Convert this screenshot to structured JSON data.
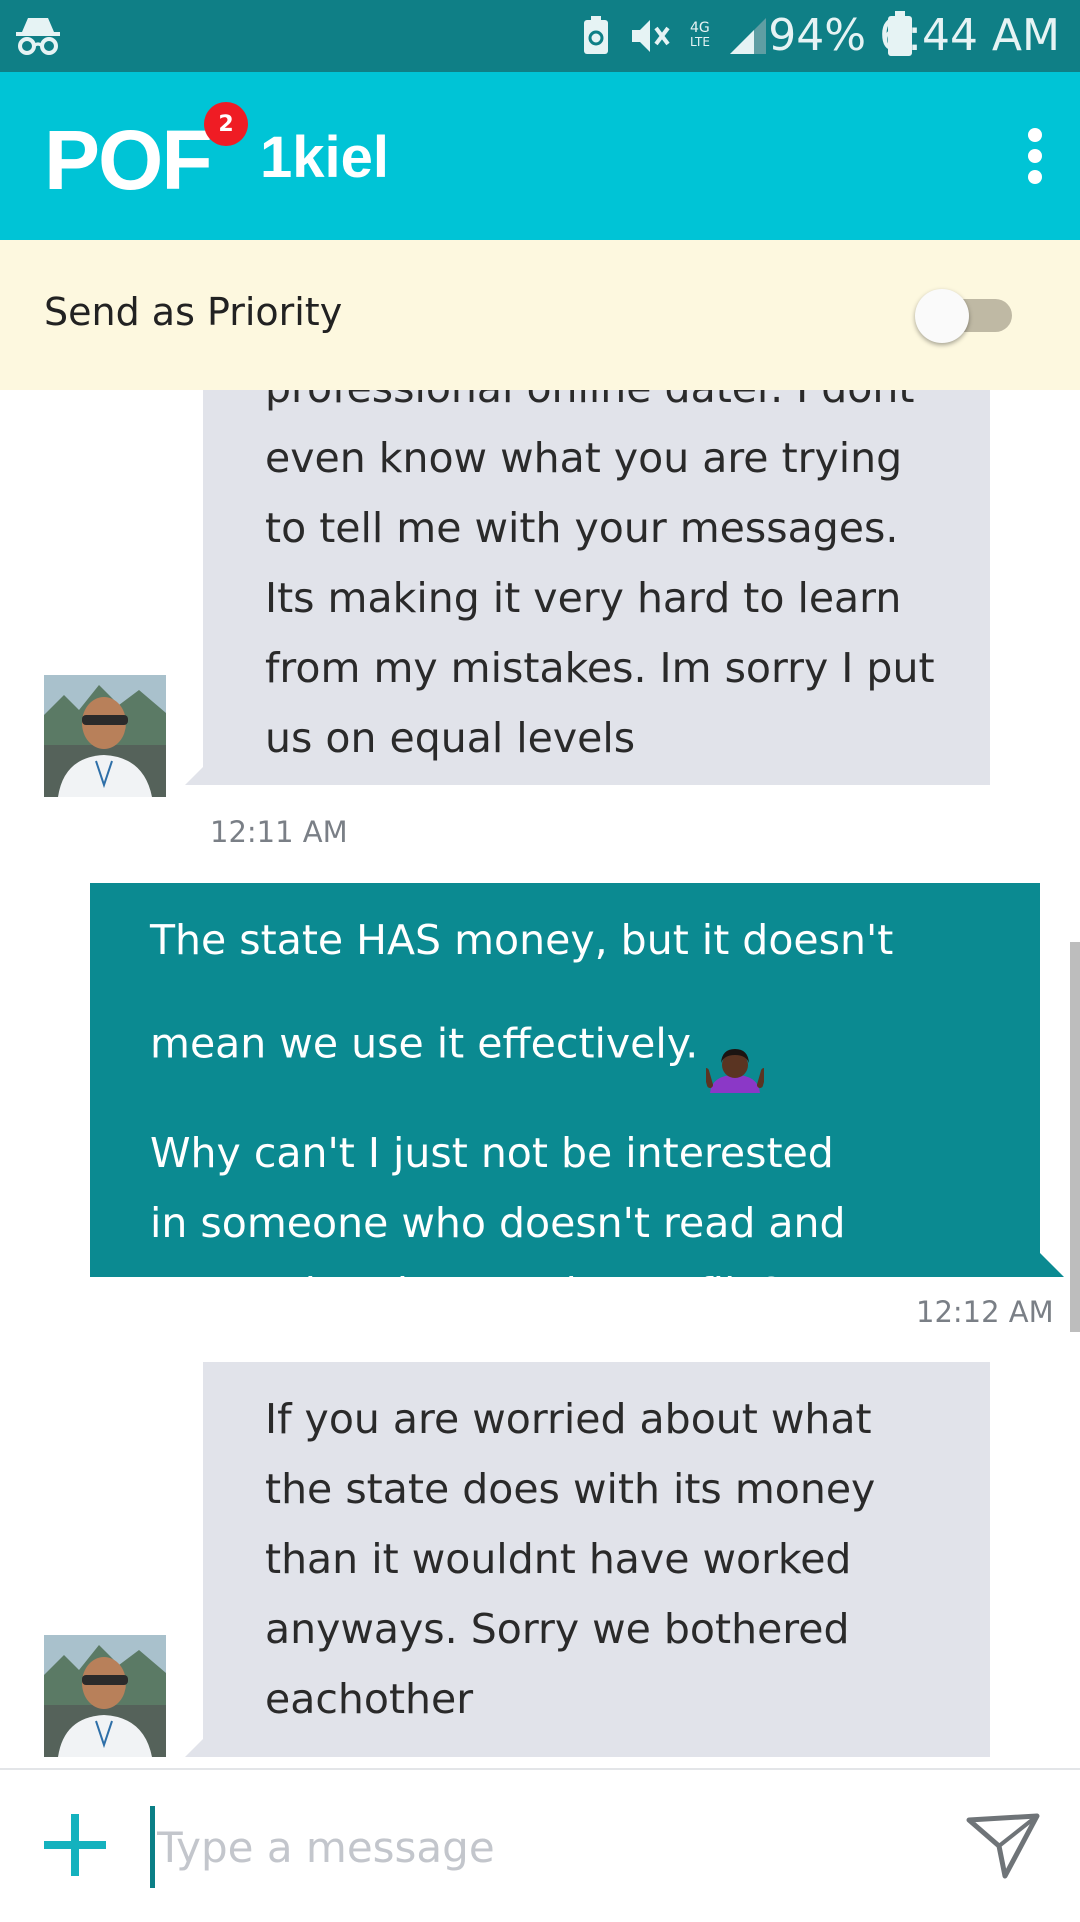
{
  "status_bar": {
    "battery_percent": "94%",
    "time": "6:44 AM",
    "network": "4G LTE"
  },
  "app_bar": {
    "logo": "POF",
    "badge_count": "2",
    "username": "1kiel"
  },
  "priority": {
    "label": "Send as Priority",
    "enabled": false
  },
  "messages": [
    {
      "direction": "in",
      "text": "professional online dater. I dont\neven know what you are trying\nto tell me with your messages.\nIts making it very hard to learn\nfrom my mistakes. Im sorry I put\nus on equal levels",
      "time": "12:11 AM"
    },
    {
      "direction": "out",
      "line1": "The state HAS money, but it doesn't",
      "line2": "mean we use it effectively.",
      "emoji": "person-shrugging-emoji",
      "rest": "Why can't I just not be interested\nin someone who doesn't read and\ncomprehend my entire profile? Dang....",
      "time": "12:12 AM"
    },
    {
      "direction": "in",
      "text": "If you are worried about what\nthe state does with its money\nthan it wouldnt have worked\nanyways. Sorry we bothered\neachother"
    }
  ],
  "composer": {
    "placeholder": "Type a message"
  },
  "colors": {
    "status_bar": "#0f7f86",
    "app_bar": "#00c4d6",
    "outgoing_bubble": "#0b8a91",
    "incoming_bubble": "#e1e3ea",
    "priority_bar": "#fdf8df",
    "badge": "#ef1c24"
  }
}
